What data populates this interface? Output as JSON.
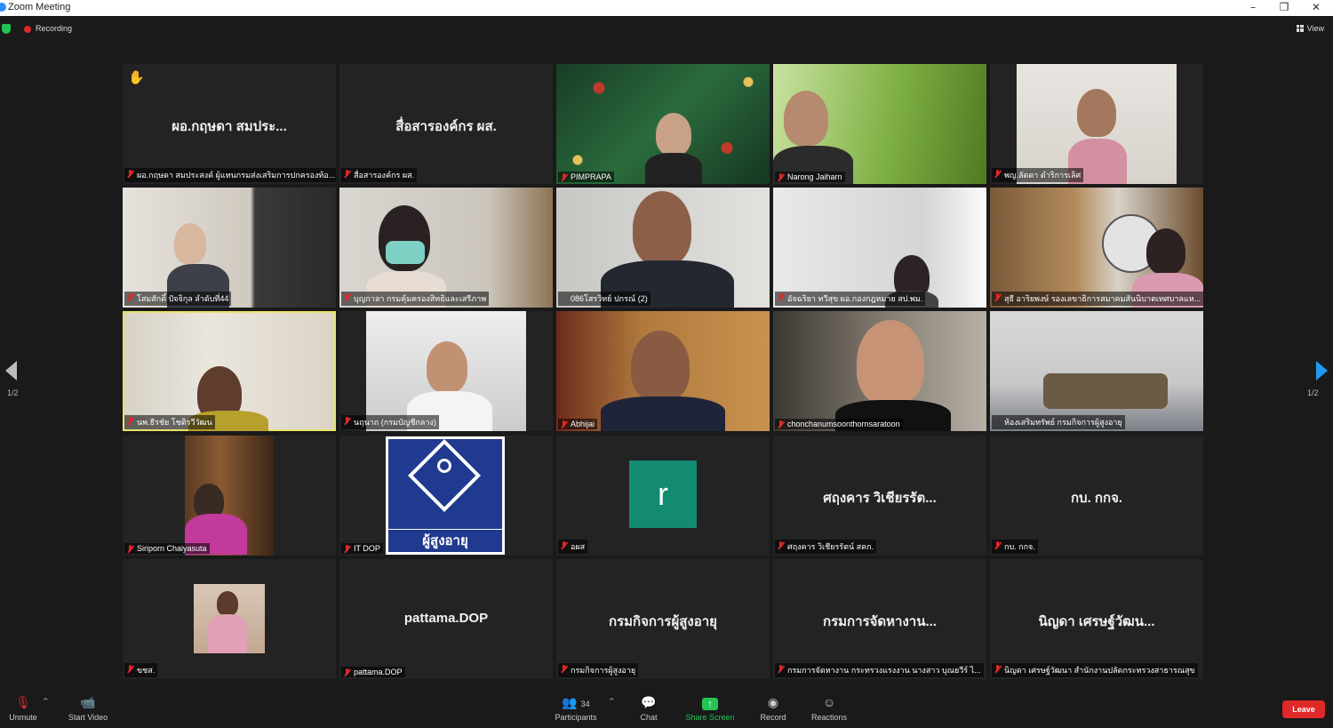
{
  "window": {
    "title": "Zoom Meeting",
    "controls": [
      "–",
      "❐",
      "✕"
    ]
  },
  "topbar": {
    "recording_label": "Recording",
    "view_label": "View"
  },
  "pagination": {
    "left_label": "1/2",
    "right_label": "1/2"
  },
  "tiles": [
    {
      "big": "ผอ.กฤษดา สมประ...",
      "label": "ผอ.กฤษดา สมประสงค์ ผู้แทนกรมส่งเสริมการปกครองท้อ..."
    },
    {
      "big": "สื่อสารองค์กร ผส.",
      "label": "สื่อสารองค์กร ผส."
    },
    {
      "big": "",
      "label": "PIMPRAPA"
    },
    {
      "big": "",
      "label": "Narong Jaiharn"
    },
    {
      "big": "",
      "label": "พญ.ลัดดา ดำริการเลิศ"
    },
    {
      "big": "",
      "label": "โสมสักดิ์ ปัจจิกุล ลำดับที่44"
    },
    {
      "big": "",
      "label": "บุญกาลา กรมคุ้มครองสิทธิและเสรีภาพ"
    },
    {
      "big": "",
      "label": "086โสรวิทย์ ปกรณ์ (2)"
    },
    {
      "big": "",
      "label": "อัจฉริยา ทวีสุข ผอ.กองกฎหมาย สป.พม."
    },
    {
      "big": "",
      "label": "สุธี อาริยพงษ์ รองเลขาธิการสมาคมสันนิบาตเทศบาลแห..."
    },
    {
      "big": "",
      "label": "นพ.ธีรชัย โชติรวีวัฒน"
    },
    {
      "big": "",
      "label": "นฤนาถ (กรมบัญชีกลาง)"
    },
    {
      "big": "",
      "label": "Abhijai"
    },
    {
      "big": "",
      "label": "chonchanumsoonthornsaratoon"
    },
    {
      "big": "",
      "label": "ห้องเสริมทรัพย์ กรมกิจการผู้สูงอายุ"
    },
    {
      "big": "",
      "label": "Siriporn Chaiyasuta"
    },
    {
      "big": "",
      "label": "IT DOP",
      "logo_text": "ผู้สูงอายุ"
    },
    {
      "big": "",
      "label": "อผส",
      "avatar_letter": "r"
    },
    {
      "big": "ศฤงคาร วิเชียรรัต...",
      "label": "ศฤงคาร วิเชียรรัตน์ สคก."
    },
    {
      "big": "กบ. กกจ.",
      "label": "กบ. กกจ."
    },
    {
      "big": "",
      "label": "ขชส."
    },
    {
      "big": "pattama.DOP",
      "label": "pattama.DOP"
    },
    {
      "big": "กรมกิจการผู้สูงอายุ",
      "label": "กรมกิจการผู้สูงอายุ"
    },
    {
      "big": "กรมการจัดหางาน...",
      "label": "กรมการจัดหางาน กระทรวงแรงงาน นางสาว บุณยวีร์ ไ..."
    },
    {
      "big": "นิญดา เศรษฐ์วัฒน...",
      "label": "นิญดา เศรษฐ์วัฒนา สำนักงานปลัดกระทรวงสาธารณสุข"
    }
  ],
  "toolbar": {
    "unmute": "Unmute",
    "start_video": "Start Video",
    "participants": "Participants",
    "participants_count": "34",
    "chat": "Chat",
    "share_screen": "Share Screen",
    "record": "Record",
    "reactions": "Reactions",
    "leave": "Leave"
  },
  "colors": {
    "accent_green": "#23c552",
    "leave_red": "#e02828",
    "active_speaker": "#e8e36a",
    "nav_blue": "#1e9bf0"
  }
}
